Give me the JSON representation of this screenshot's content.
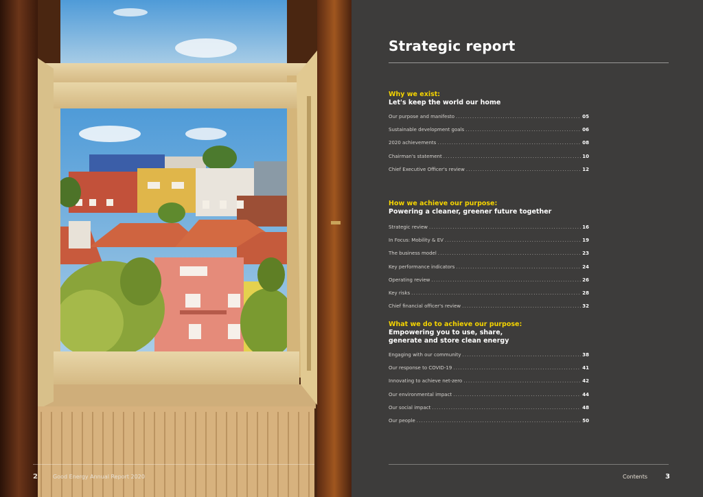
{
  "left_page": {
    "page_number": "2",
    "running_title": "Good Energy Annual Report 2020"
  },
  "right_page": {
    "title": "Strategic report",
    "sections": [
      {
        "heading": "Why we exist:",
        "subheading": "Let's keep the world our home",
        "items": [
          {
            "label": "Our purpose and manifesto",
            "page": "05"
          },
          {
            "label": "Sustainable development goals",
            "page": "06"
          },
          {
            "label": "2020 achievements",
            "page": "08"
          },
          {
            "label": "Chairman's statement",
            "page": "10"
          },
          {
            "label": "Chief Executive Officer's review",
            "page": "12"
          }
        ]
      },
      {
        "heading": "How we achieve our purpose:",
        "subheading": "Powering a cleaner, greener future together",
        "items": [
          {
            "label": "Strategic review",
            "page": "16"
          },
          {
            "label": "In Focus: Mobility & EV",
            "page": "19"
          },
          {
            "label": "The business model",
            "page": "23"
          },
          {
            "label": "Key performance indicators",
            "page": "24"
          },
          {
            "label": "Operating review",
            "page": "26"
          },
          {
            "label": "Key risks",
            "page": "28"
          },
          {
            "label": "Chief financial officer's review",
            "page": "32"
          }
        ]
      },
      {
        "heading": "What we do to achieve our purpose:",
        "subheading": "Empowering you to use, share, generate and store clean energy",
        "items": [
          {
            "label": "Engaging with our community",
            "page": "38"
          },
          {
            "label": "Our response to COVID-19",
            "page": "41"
          },
          {
            "label": "Innovating to achieve net-zero",
            "page": "42"
          },
          {
            "label": "Our environmental impact",
            "page": "44"
          },
          {
            "label": "Our social impact",
            "page": "48"
          },
          {
            "label": "Our people",
            "page": "50"
          }
        ]
      }
    ],
    "footer_label": "Contents",
    "page_number": "3"
  },
  "colors": {
    "background": "#3d3c3b",
    "accent_yellow": "#f5d400",
    "text_white": "#ffffff"
  }
}
